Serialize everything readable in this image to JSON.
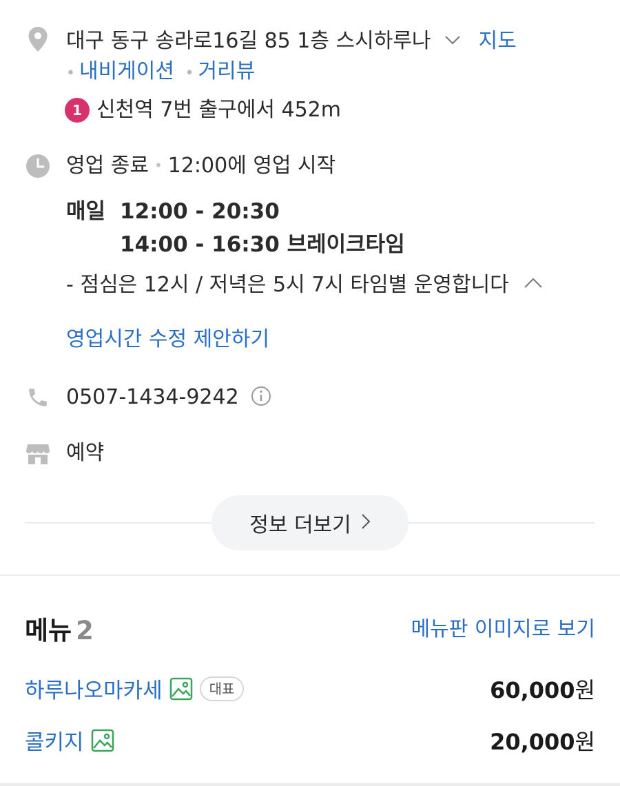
{
  "address": {
    "text": "대구 동구 송라로16길 85 1층 스시하루나",
    "map_link": "지도",
    "navigation_link": "내비게이션",
    "streetview_link": "거리뷰"
  },
  "subway": {
    "line": "1",
    "line_color": "#d9316c",
    "text": "신천역 7번 출구에서 452m"
  },
  "hours": {
    "status": "영업 종료",
    "next": "12:00에 영업 시작",
    "day_label": "매일",
    "main_hours": "12:00 - 20:30",
    "break_hours": "14:00 - 16:30 브레이크타임",
    "note": "- 점심은 12시 / 저녁은 5시 7시 타임별 운영합니다",
    "edit_link": "영업시간 수정 제안하기"
  },
  "phone": {
    "number": "0507-1434-9242"
  },
  "reservation": {
    "label": "예약"
  },
  "more_button": {
    "label": "정보 더보기"
  },
  "menu": {
    "title": "메뉴",
    "count": "2",
    "image_link": "메뉴판 이미지로 보기",
    "items": [
      {
        "name": "하루나오마카세",
        "badge": "대표",
        "price": "60,000",
        "unit": "원"
      },
      {
        "name": "콜키지",
        "price": "20,000",
        "unit": "원"
      }
    ]
  },
  "colors": {
    "link": "#2a6fc4",
    "icon_gray": "#bdbdbd",
    "image_icon": "#3aa65a"
  }
}
